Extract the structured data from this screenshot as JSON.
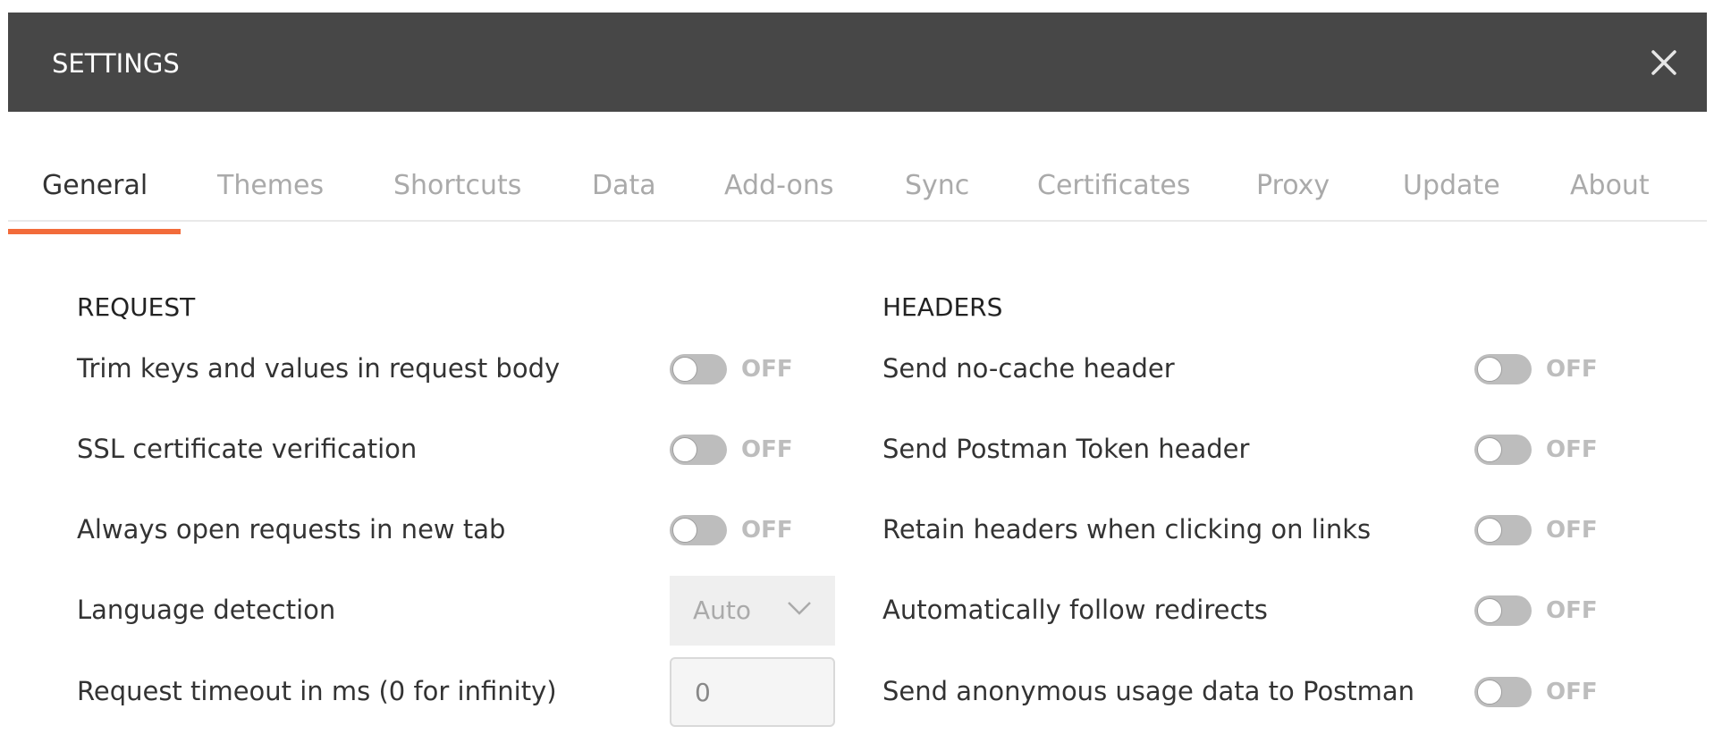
{
  "header": {
    "title": "SETTINGS",
    "close_icon": "close-icon"
  },
  "tabs": [
    {
      "label": "General",
      "active": true
    },
    {
      "label": "Themes",
      "active": false
    },
    {
      "label": "Shortcuts",
      "active": false
    },
    {
      "label": "Data",
      "active": false
    },
    {
      "label": "Add-ons",
      "active": false
    },
    {
      "label": "Sync",
      "active": false
    },
    {
      "label": "Certificates",
      "active": false
    },
    {
      "label": "Proxy",
      "active": false
    },
    {
      "label": "Update",
      "active": false
    },
    {
      "label": "About",
      "active": false
    }
  ],
  "colors": {
    "header_bg": "#474747",
    "accent": "#f26b3a",
    "toggle_off": "#bdbdbd"
  },
  "request": {
    "title": "REQUEST",
    "rows": [
      {
        "label": "Trim keys and values in request body",
        "control": "toggle",
        "state": "OFF"
      },
      {
        "label": "SSL certificate verification",
        "control": "toggle",
        "state": "OFF"
      },
      {
        "label": "Always open requests in new tab",
        "control": "toggle",
        "state": "OFF"
      },
      {
        "label": "Language detection",
        "control": "select",
        "value": "Auto"
      },
      {
        "label": "Request timeout in ms (0 for infinity)",
        "control": "input",
        "value": "0"
      }
    ]
  },
  "headers": {
    "title": "HEADERS",
    "rows": [
      {
        "label": "Send no-cache header",
        "state": "OFF"
      },
      {
        "label": "Send Postman Token header",
        "state": "OFF"
      },
      {
        "label": "Retain headers when clicking on links",
        "state": "OFF"
      },
      {
        "label": "Automatically follow redirects",
        "state": "OFF"
      },
      {
        "label": "Send anonymous usage data to Postman",
        "state": "OFF"
      }
    ]
  }
}
